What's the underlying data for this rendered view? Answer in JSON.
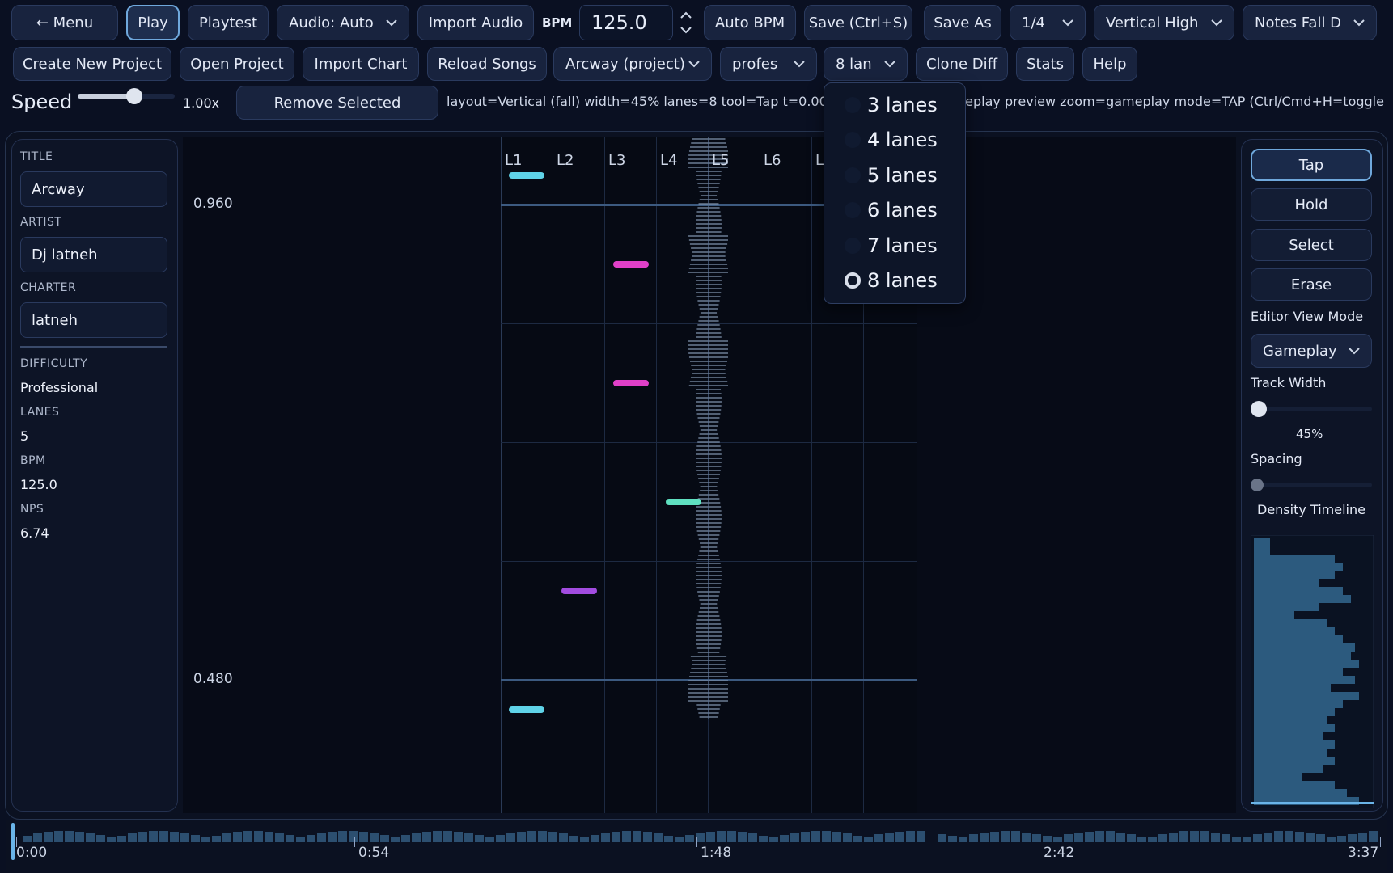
{
  "toolbar_row1": {
    "menu": "← Menu",
    "play": "Play",
    "playtest": "Playtest",
    "audio_select": "Audio: Auto",
    "import_audio": "Import Audio",
    "bpm_label": "BPM",
    "bpm_value": "125.0",
    "auto_bpm": "Auto BPM",
    "save": "Save (Ctrl+S)",
    "save_as": "Save As",
    "snap_select": "1/4",
    "layout_select": "Vertical High",
    "direction_select": "Notes Fall D"
  },
  "toolbar_row2": {
    "create_project": "Create New Project",
    "open_project": "Open Project",
    "import_chart": "Import Chart",
    "reload_songs": "Reload Songs",
    "project_select": "Arcway (project)",
    "difficulty_select": "profes",
    "lanes_select": "8 lan",
    "clone_diff": "Clone Diff",
    "stats": "Stats",
    "help": "Help"
  },
  "toolbar_row3": {
    "speed_label": "Speed",
    "speed_value": "1.00x",
    "speed_fraction": 0.62,
    "remove_selected": "Remove Selected",
    "status_text": "layout=Vertical (fall) width=45%  lanes=8  tool=Tap  t=0.000",
    "status_text_right": "eplay preview  zoom=gameplay  mode=TAP  (Ctrl/Cmd+H=toggle I"
  },
  "lanes_dropdown": {
    "options": [
      "3 lanes",
      "4 lanes",
      "5 lanes",
      "6 lanes",
      "7 lanes",
      "8 lanes"
    ],
    "selected": "8 lanes"
  },
  "metadata": {
    "title_label": "TITLE",
    "title_value": "Arcway",
    "artist_label": "ARTIST",
    "artist_value": "Dj latneh",
    "charter_label": "CHARTER",
    "charter_value": "latneh",
    "difficulty_label": "DIFFICULTY",
    "difficulty_value": "Professional",
    "lanes_label": "LANES",
    "lanes_value": "5",
    "bpm_label": "BPM",
    "bpm_value": "125.0",
    "nps_label": "NPS",
    "nps_value": "6.74"
  },
  "editor": {
    "lane_labels": [
      "L1",
      "L2",
      "L3",
      "L4",
      "L5",
      "L6",
      "L"
    ],
    "time_markers": [
      "0.960",
      "0.480"
    ],
    "notes": [
      {
        "lane": 1,
        "color": "#5fd3e8"
      },
      {
        "lane": 3,
        "color": "#e040c8"
      },
      {
        "lane": 3,
        "color": "#e040c8"
      },
      {
        "lane": 4,
        "color": "#5fe0c0"
      },
      {
        "lane": 2,
        "color": "#a24ce0"
      },
      {
        "lane": 1,
        "color": "#5fd3e8"
      }
    ]
  },
  "tools": {
    "tap": "Tap",
    "hold": "Hold",
    "select": "Select",
    "erase": "Erase",
    "active": "Tap",
    "view_mode_label": "Editor View Mode",
    "view_mode_value": "Gameplay",
    "track_width_label": "Track Width",
    "track_width_value": "45%",
    "track_width_fraction": 0.0,
    "spacing_label": "Spacing",
    "spacing_fraction": 0.0,
    "density_label": "Density Timeline"
  },
  "timeline": {
    "labels": [
      "0:00",
      "0:54",
      "1:48",
      "2:42",
      "3:37"
    ]
  },
  "colors": {
    "accent": "#6fa8dc",
    "background": "#0a1022",
    "density_fill": "#2c5a7e"
  }
}
